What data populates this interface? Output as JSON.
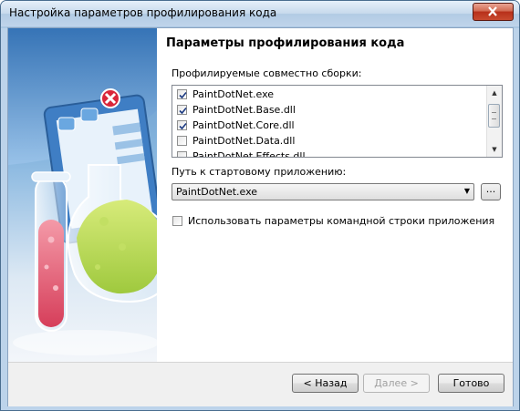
{
  "window": {
    "title": "Настройка параметров профилирования кода"
  },
  "page": {
    "heading": "Параметры профилирования кода",
    "assemblies_label": "Профилируемые совместно сборки:",
    "assemblies": [
      {
        "name": "PaintDotNet.exe",
        "checked": true
      },
      {
        "name": "PaintDotNet.Base.dll",
        "checked": true
      },
      {
        "name": "PaintDotNet.Core.dll",
        "checked": true
      },
      {
        "name": "PaintDotNet.Data.dll",
        "checked": false
      },
      {
        "name": "PaintDotNet.Effects.dll",
        "checked": false
      }
    ],
    "startup_label": "Путь к стартовому приложению:",
    "startup_value": "PaintDotNet.exe",
    "browse_label": "...",
    "cmdline_label": "Использовать параметры командной строки приложения",
    "cmdline_checked": false
  },
  "footer": {
    "back": "< Назад",
    "next": "Далее >",
    "finish": "Готово"
  }
}
